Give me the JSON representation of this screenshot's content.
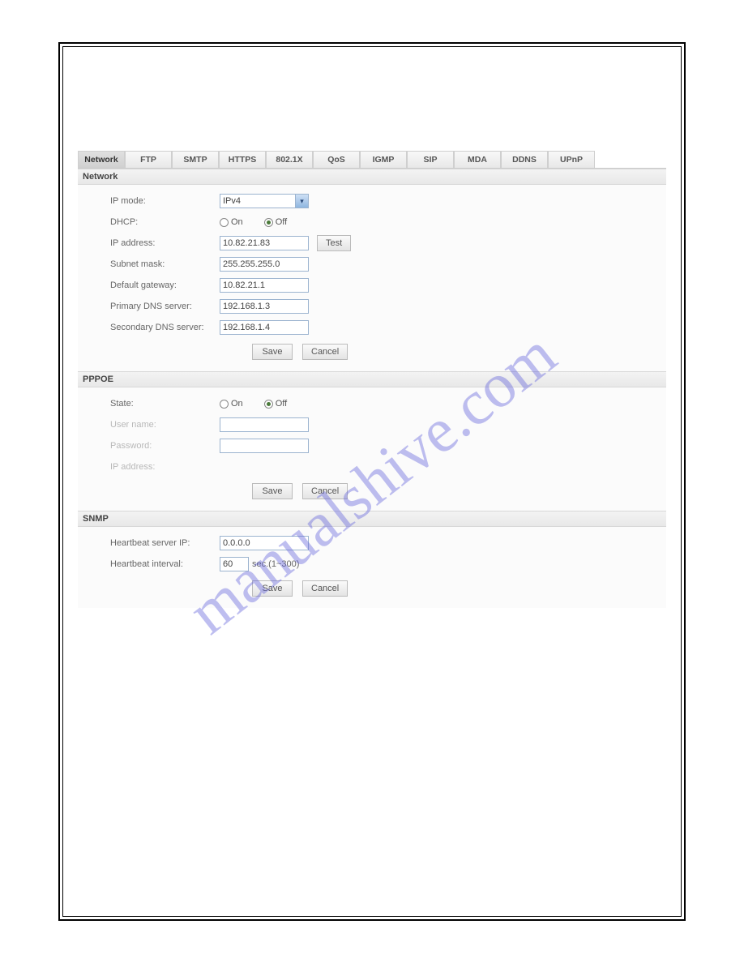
{
  "watermark": "manualshive.com",
  "tabs": {
    "t0": "Network",
    "t1": "FTP",
    "t2": "SMTP",
    "t3": "HTTPS",
    "t4": "802.1X",
    "t5": "QoS",
    "t6": "IGMP",
    "t7": "SIP",
    "t8": "MDA",
    "t9": "DDNS",
    "t10": "UPnP"
  },
  "network": {
    "header": "Network",
    "ip_mode_label": "IP mode:",
    "ip_mode_value": "IPv4",
    "dhcp_label": "DHCP:",
    "dhcp_on": "On",
    "dhcp_off": "Off",
    "dhcp_value": "Off",
    "ip_address_label": "IP address:",
    "ip_address_value": "10.82.21.83",
    "test_btn": "Test",
    "subnet_label": "Subnet mask:",
    "subnet_value": "255.255.255.0",
    "gateway_label": "Default gateway:",
    "gateway_value": "10.82.21.1",
    "primary_dns_label": "Primary DNS server:",
    "primary_dns_value": "192.168.1.3",
    "secondary_dns_label": "Secondary DNS server:",
    "secondary_dns_value": "192.168.1.4",
    "save_btn": "Save",
    "cancel_btn": "Cancel"
  },
  "pppoe": {
    "header": "PPPOE",
    "state_label": "State:",
    "state_on": "On",
    "state_off": "Off",
    "state_value": "Off",
    "username_label": "User name:",
    "username_value": "",
    "password_label": "Password:",
    "password_value": "",
    "ip_address_label": "IP address:",
    "ip_address_value": "",
    "save_btn": "Save",
    "cancel_btn": "Cancel"
  },
  "snmp": {
    "header": "SNMP",
    "heartbeat_ip_label": "Heartbeat server IP:",
    "heartbeat_ip_value": "0.0.0.0",
    "heartbeat_interval_label": "Heartbeat interval:",
    "heartbeat_interval_value": "60",
    "heartbeat_interval_suffix": "sec.(1~300)",
    "save_btn": "Save",
    "cancel_btn": "Cancel"
  }
}
